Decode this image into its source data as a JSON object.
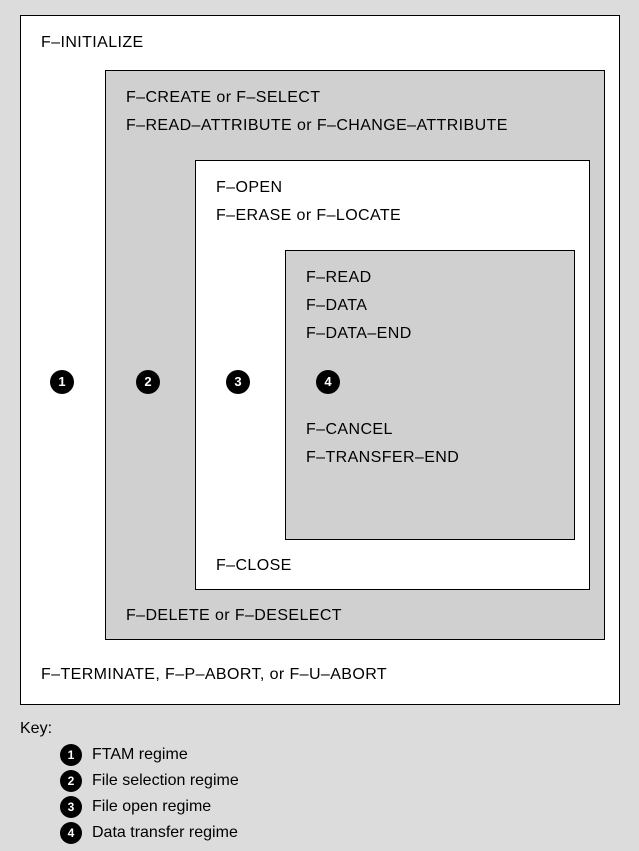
{
  "box1": {
    "top": "F–INITIALIZE",
    "bottom": "F–TERMINATE, F–P–ABORT, or F–U–ABORT"
  },
  "box2": {
    "top1": "F–CREATE or F–SELECT",
    "top2": "F–READ–ATTRIBUTE or F–CHANGE–ATTRIBUTE",
    "bottom": "F–DELETE or F–DESELECT"
  },
  "box3": {
    "top1": "F–OPEN",
    "top2": "F–ERASE or F–LOCATE",
    "bottom": "F–CLOSE"
  },
  "box4": {
    "l1": "F–READ",
    "l2": "F–DATA",
    "l3": "F–DATA–END",
    "l4": "F–CANCEL",
    "l5": "F–TRANSFER–END"
  },
  "badges": {
    "b1": "1",
    "b2": "2",
    "b3": "3",
    "b4": "4"
  },
  "key": {
    "title": "Key:",
    "items": [
      {
        "num": "1",
        "text": "FTAM regime"
      },
      {
        "num": "2",
        "text": "File selection regime"
      },
      {
        "num": "3",
        "text": "File open regime"
      },
      {
        "num": "4",
        "text": "Data transfer regime"
      }
    ]
  }
}
